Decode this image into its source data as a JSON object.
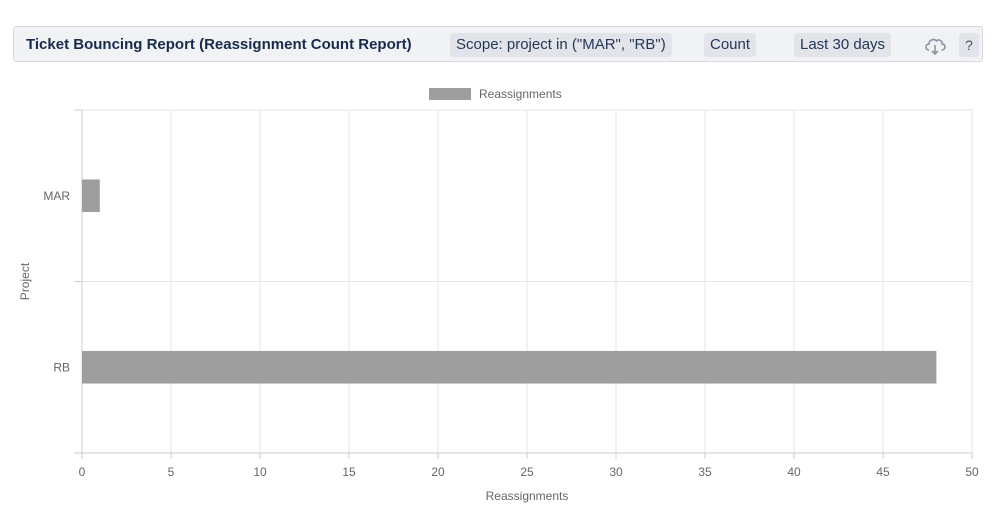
{
  "header": {
    "title": "Ticket Bouncing Report (Reassignment Count Report)",
    "scope": "Scope: project in (\"MAR\", \"RB\")",
    "metric": "Count",
    "period": "Last 30 days",
    "download_icon": "cloud-download-icon",
    "help": "?"
  },
  "chart_data": {
    "type": "bar",
    "orientation": "horizontal",
    "categories": [
      "MAR",
      "RB"
    ],
    "series": [
      {
        "name": "Reassignments",
        "values": [
          1,
          48
        ],
        "color": "#9e9e9e"
      }
    ],
    "xlabel": "Reassignments",
    "ylabel": "Project",
    "xlim": [
      0,
      50
    ],
    "xticks": [
      "0",
      "5",
      "10",
      "15",
      "20",
      "25",
      "30",
      "35",
      "40",
      "45",
      "50"
    ],
    "grid": true,
    "legend": "top-center"
  }
}
